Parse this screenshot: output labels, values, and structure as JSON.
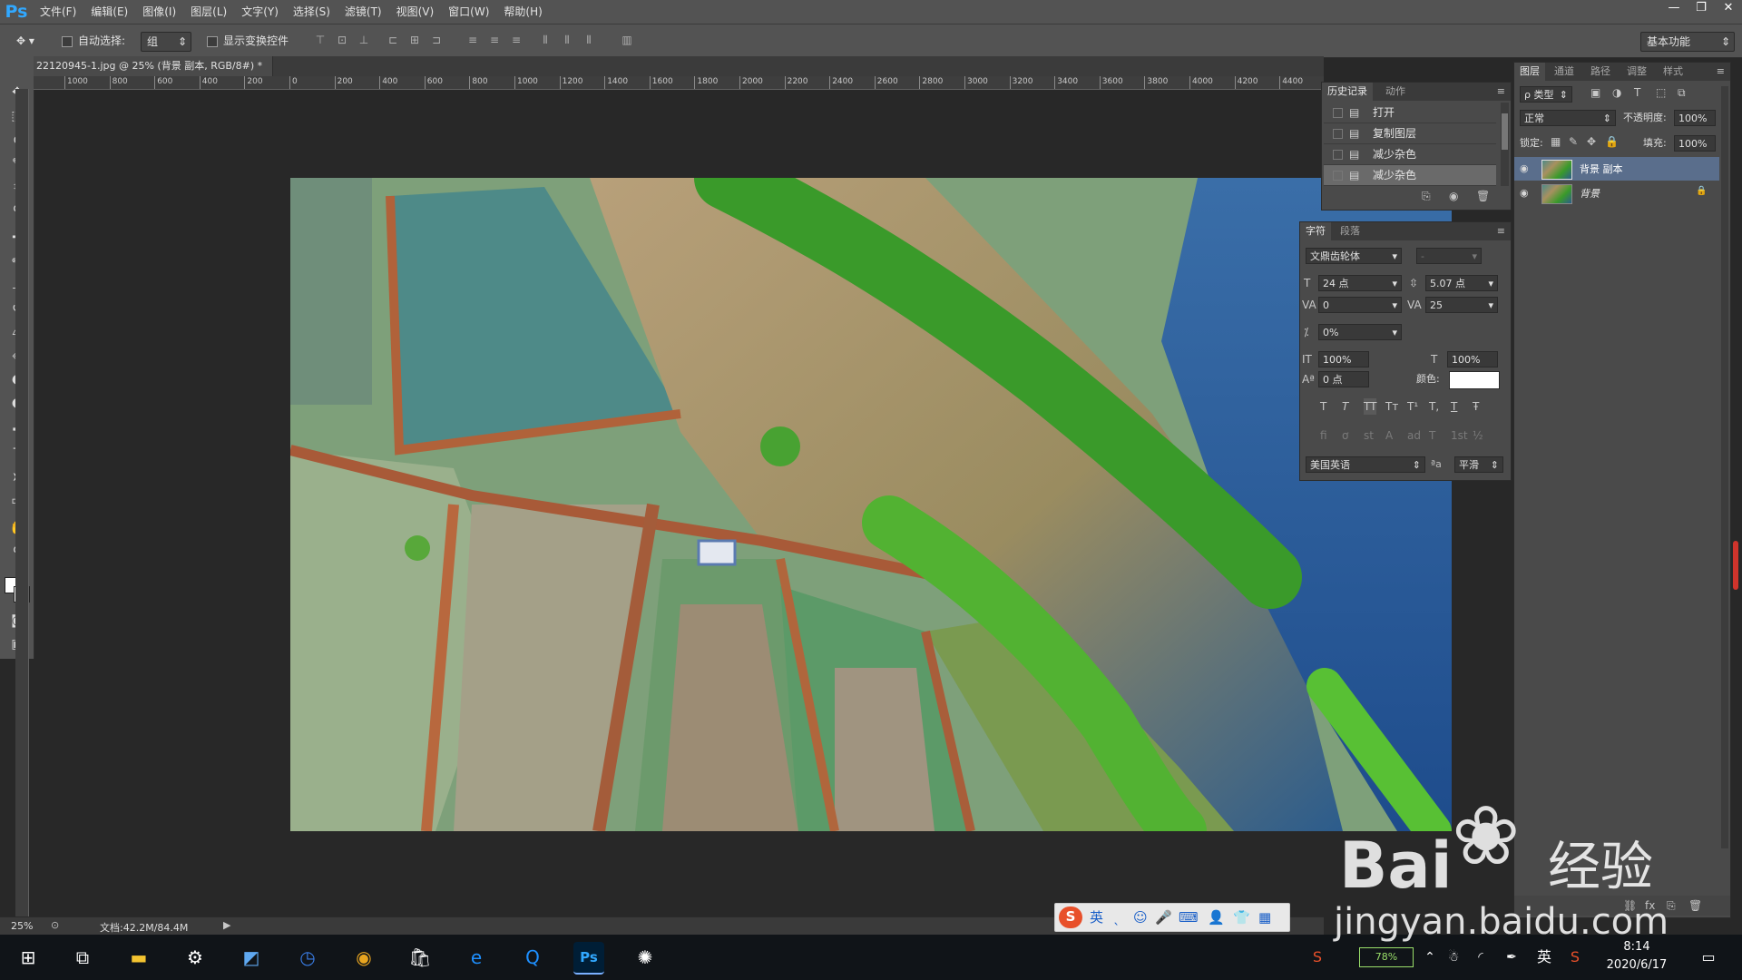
{
  "app": {
    "logo": "Ps",
    "menu": [
      "文件(F)",
      "编辑(E)",
      "图像(I)",
      "图层(L)",
      "文字(Y)",
      "选择(S)",
      "滤镜(T)",
      "视图(V)",
      "窗口(W)",
      "帮助(H)"
    ],
    "window_controls": [
      "—",
      "❐",
      "✕"
    ]
  },
  "options_bar": {
    "auto_select_label": "自动选择:",
    "auto_select_value": "组",
    "show_transform_label": "显示变换控件",
    "workspace_value": "基本功能"
  },
  "document": {
    "tab_title": "22120945-1.jpg @ 25% (背景 副本, RGB/8#) *",
    "close_glyph": "×",
    "ruler_ticks": [
      "1000",
      "800",
      "600",
      "400",
      "200",
      "0",
      "200",
      "400",
      "600",
      "800",
      "1000",
      "1200",
      "1400",
      "1600",
      "1800",
      "2000",
      "2200",
      "2400",
      "2600",
      "2800",
      "3000",
      "3200",
      "3400",
      "3600",
      "3800",
      "4000",
      "4200",
      "4400"
    ]
  },
  "status": {
    "zoom": "25%",
    "doc_size": "文档:42.2M/84.4M"
  },
  "history_panel": {
    "tabs": [
      "历史记录",
      "动作"
    ],
    "items": [
      "打开",
      "复制图层",
      "减少杂色",
      "减少杂色"
    ]
  },
  "character_panel": {
    "tabs": [
      "字符",
      "段落"
    ],
    "font_family": "文鼎齿轮体",
    "font_style": "-",
    "font_size": "24 点",
    "leading": "5.07 点",
    "kerning": "0",
    "tracking": "25",
    "tsume": "0%",
    "vertical_scale": "100%",
    "horizontal_scale": "100%",
    "baseline_shift": "0 点",
    "color_label": "颜色:",
    "language": "美国英语",
    "aa_label": "ªa",
    "antialias": "平滑",
    "style_buttons": [
      "T",
      "T",
      "TT",
      "Tт",
      "T¹",
      "T,",
      "T",
      "Ŧ"
    ],
    "opentype_buttons": [
      "fi",
      "ơ",
      "st",
      "A",
      "ad",
      "T",
      "1st",
      "½"
    ]
  },
  "layers_panel": {
    "tabs": [
      "图层",
      "通道",
      "路径",
      "调整",
      "样式"
    ],
    "filter_label": "ρ 类型",
    "blend_mode": "正常",
    "opacity_label": "不透明度:",
    "opacity": "100%",
    "lock_label": "锁定:",
    "fill_label": "填充:",
    "fill": "100%",
    "layers": [
      {
        "name": "背景 副本",
        "selected": true
      },
      {
        "name": "背景",
        "selected": false
      }
    ]
  },
  "ime_bar": {
    "items": [
      "S",
      "英",
      "ˎ",
      "☺",
      "🎤",
      "⌨",
      "👤",
      "👕",
      "▦"
    ]
  },
  "taskbar": {
    "battery": "78%",
    "ime_lang": "英",
    "time": "8:14",
    "date": "2020/6/17"
  },
  "watermark": {
    "brand": "Bai",
    "brand_suffix": "经验",
    "url": "jingyan.baidu.com"
  },
  "colors": {
    "accent": "#31a8ff",
    "panel_bg": "#4a4a4a",
    "selected_layer": "#5a6e8c"
  }
}
